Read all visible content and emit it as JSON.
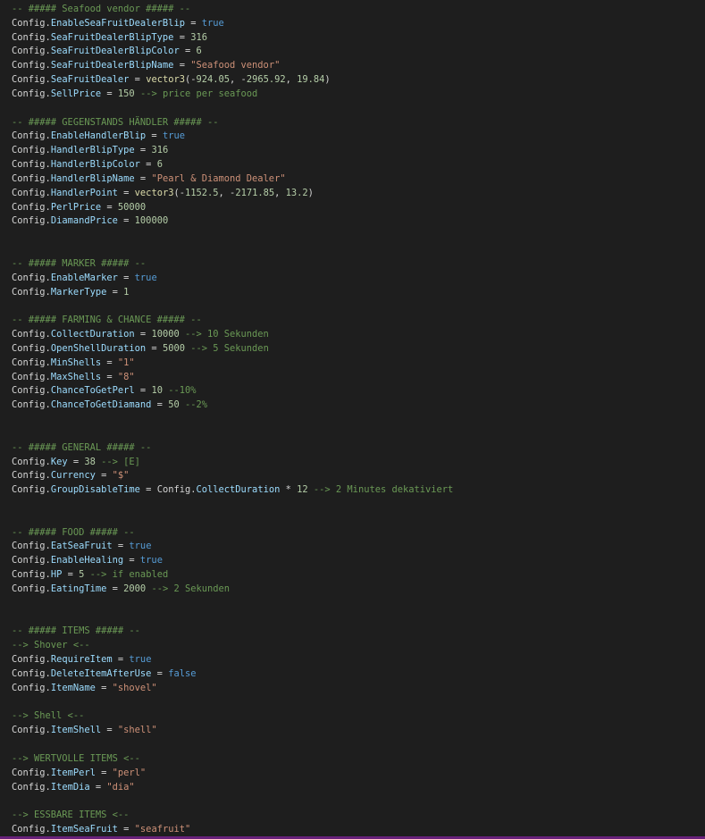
{
  "editor": {
    "theme_colors": {
      "background": "#1e1e1e",
      "comment": "#6a9955",
      "property": "#9cdcfe",
      "number": "#b5cea8",
      "string": "#ce9178",
      "keyword": "#569cd6",
      "function": "#dcdcaa",
      "status_bar": "#68217a"
    },
    "lines": [
      [
        [
          "cm",
          "-- ##### Seafood vendor ##### --"
        ]
      ],
      [
        [
          "cfg",
          "Config"
        ],
        [
          "dot",
          "."
        ],
        [
          "prop",
          "EnableSeaFruitDealerBlip"
        ],
        [
          "op",
          " = "
        ],
        [
          "kw",
          "true"
        ]
      ],
      [
        [
          "cfg",
          "Config"
        ],
        [
          "dot",
          "."
        ],
        [
          "prop",
          "SeaFruitDealerBlipType"
        ],
        [
          "op",
          " = "
        ],
        [
          "num",
          "316"
        ]
      ],
      [
        [
          "cfg",
          "Config"
        ],
        [
          "dot",
          "."
        ],
        [
          "prop",
          "SeaFruitDealerBlipColor"
        ],
        [
          "op",
          " = "
        ],
        [
          "num",
          "6"
        ]
      ],
      [
        [
          "cfg",
          "Config"
        ],
        [
          "dot",
          "."
        ],
        [
          "prop",
          "SeaFruitDealerBlipName"
        ],
        [
          "op",
          " = "
        ],
        [
          "str",
          "\"Seafood vendor\""
        ]
      ],
      [
        [
          "cfg",
          "Config"
        ],
        [
          "dot",
          "."
        ],
        [
          "prop",
          "SeaFruitDealer"
        ],
        [
          "op",
          " = "
        ],
        [
          "fn",
          "vector3"
        ],
        [
          "op",
          "(-"
        ],
        [
          "num",
          "924.05"
        ],
        [
          "op",
          ", -"
        ],
        [
          "num",
          "2965.92"
        ],
        [
          "op",
          ", "
        ],
        [
          "num",
          "19.84"
        ],
        [
          "op",
          ")"
        ]
      ],
      [
        [
          "cfg",
          "Config"
        ],
        [
          "dot",
          "."
        ],
        [
          "prop",
          "SellPrice"
        ],
        [
          "op",
          " = "
        ],
        [
          "num",
          "150"
        ],
        [
          "cm",
          " --> price per seafood"
        ]
      ],
      [],
      [
        [
          "cm",
          "-- ##### GEGENSTANDS HÄNDLER ##### --"
        ]
      ],
      [
        [
          "cfg",
          "Config"
        ],
        [
          "dot",
          "."
        ],
        [
          "prop",
          "EnableHandlerBlip"
        ],
        [
          "op",
          " = "
        ],
        [
          "kw",
          "true"
        ]
      ],
      [
        [
          "cfg",
          "Config"
        ],
        [
          "dot",
          "."
        ],
        [
          "prop",
          "HandlerBlipType"
        ],
        [
          "op",
          " = "
        ],
        [
          "num",
          "316"
        ]
      ],
      [
        [
          "cfg",
          "Config"
        ],
        [
          "dot",
          "."
        ],
        [
          "prop",
          "HandlerBlipColor"
        ],
        [
          "op",
          " = "
        ],
        [
          "num",
          "6"
        ]
      ],
      [
        [
          "cfg",
          "Config"
        ],
        [
          "dot",
          "."
        ],
        [
          "prop",
          "HandlerBlipName"
        ],
        [
          "op",
          " = "
        ],
        [
          "str",
          "\"Pearl & Diamond Dealer\""
        ]
      ],
      [
        [
          "cfg",
          "Config"
        ],
        [
          "dot",
          "."
        ],
        [
          "prop",
          "HandlerPoint"
        ],
        [
          "op",
          " = "
        ],
        [
          "fn",
          "vector3"
        ],
        [
          "op",
          "(-"
        ],
        [
          "num",
          "1152.5"
        ],
        [
          "op",
          ", -"
        ],
        [
          "num",
          "2171.85"
        ],
        [
          "op",
          ", "
        ],
        [
          "num",
          "13.2"
        ],
        [
          "op",
          ")"
        ]
      ],
      [
        [
          "cfg",
          "Config"
        ],
        [
          "dot",
          "."
        ],
        [
          "prop",
          "PerlPrice"
        ],
        [
          "op",
          " = "
        ],
        [
          "num",
          "50000"
        ]
      ],
      [
        [
          "cfg",
          "Config"
        ],
        [
          "dot",
          "."
        ],
        [
          "prop",
          "DiamandPrice"
        ],
        [
          "op",
          " = "
        ],
        [
          "num",
          "100000"
        ]
      ],
      [],
      [],
      [
        [
          "cm",
          "-- ##### MARKER ##### --"
        ]
      ],
      [
        [
          "cfg",
          "Config"
        ],
        [
          "dot",
          "."
        ],
        [
          "prop",
          "EnableMarker"
        ],
        [
          "op",
          " = "
        ],
        [
          "kw",
          "true"
        ]
      ],
      [
        [
          "cfg",
          "Config"
        ],
        [
          "dot",
          "."
        ],
        [
          "prop",
          "MarkerType"
        ],
        [
          "op",
          " = "
        ],
        [
          "num",
          "1"
        ]
      ],
      [],
      [
        [
          "cm",
          "-- ##### FARMING & CHANCE ##### --"
        ]
      ],
      [
        [
          "cfg",
          "Config"
        ],
        [
          "dot",
          "."
        ],
        [
          "prop",
          "CollectDuration"
        ],
        [
          "op",
          " = "
        ],
        [
          "num",
          "10000"
        ],
        [
          "cm",
          " --> 10 Sekunden"
        ]
      ],
      [
        [
          "cfg",
          "Config"
        ],
        [
          "dot",
          "."
        ],
        [
          "prop",
          "OpenShellDuration"
        ],
        [
          "op",
          " = "
        ],
        [
          "num",
          "5000"
        ],
        [
          "cm",
          " --> 5 Sekunden"
        ]
      ],
      [
        [
          "cfg",
          "Config"
        ],
        [
          "dot",
          "."
        ],
        [
          "prop",
          "MinShells"
        ],
        [
          "op",
          " = "
        ],
        [
          "str",
          "\"1\""
        ]
      ],
      [
        [
          "cfg",
          "Config"
        ],
        [
          "dot",
          "."
        ],
        [
          "prop",
          "MaxShells"
        ],
        [
          "op",
          " = "
        ],
        [
          "str",
          "\"8\""
        ]
      ],
      [
        [
          "cfg",
          "Config"
        ],
        [
          "dot",
          "."
        ],
        [
          "prop",
          "ChanceToGetPerl"
        ],
        [
          "op",
          " = "
        ],
        [
          "num",
          "10"
        ],
        [
          "cm",
          " --10%"
        ]
      ],
      [
        [
          "cfg",
          "Config"
        ],
        [
          "dot",
          "."
        ],
        [
          "prop",
          "ChanceToGetDiamand"
        ],
        [
          "op",
          " = "
        ],
        [
          "num",
          "50"
        ],
        [
          "cm",
          " --2%"
        ]
      ],
      [],
      [],
      [
        [
          "cm",
          "-- ##### GENERAL ##### --"
        ]
      ],
      [
        [
          "cfg",
          "Config"
        ],
        [
          "dot",
          "."
        ],
        [
          "prop",
          "Key"
        ],
        [
          "op",
          " = "
        ],
        [
          "num",
          "38"
        ],
        [
          "cm",
          " --> [E]"
        ]
      ],
      [
        [
          "cfg",
          "Config"
        ],
        [
          "dot",
          "."
        ],
        [
          "prop",
          "Currency"
        ],
        [
          "op",
          " = "
        ],
        [
          "str",
          "\"$\""
        ]
      ],
      [
        [
          "cfg",
          "Config"
        ],
        [
          "dot",
          "."
        ],
        [
          "prop",
          "GroupDisableTime"
        ],
        [
          "op",
          " = "
        ],
        [
          "cfg",
          "Config"
        ],
        [
          "dot",
          "."
        ],
        [
          "prop",
          "CollectDuration"
        ],
        [
          "op",
          " * "
        ],
        [
          "num",
          "12"
        ],
        [
          "cm",
          " --> 2 Minutes dekativiert"
        ]
      ],
      [],
      [],
      [
        [
          "cm",
          "-- ##### FOOD ##### --"
        ]
      ],
      [
        [
          "cfg",
          "Config"
        ],
        [
          "dot",
          "."
        ],
        [
          "prop",
          "EatSeaFruit"
        ],
        [
          "op",
          " = "
        ],
        [
          "kw",
          "true"
        ]
      ],
      [
        [
          "cfg",
          "Config"
        ],
        [
          "dot",
          "."
        ],
        [
          "prop",
          "EnableHealing"
        ],
        [
          "op",
          " = "
        ],
        [
          "kw",
          "true"
        ]
      ],
      [
        [
          "cfg",
          "Config"
        ],
        [
          "dot",
          "."
        ],
        [
          "prop",
          "HP"
        ],
        [
          "op",
          " = "
        ],
        [
          "num",
          "5"
        ],
        [
          "cm",
          " --> if enabled"
        ]
      ],
      [
        [
          "cfg",
          "Config"
        ],
        [
          "dot",
          "."
        ],
        [
          "prop",
          "EatingTime"
        ],
        [
          "op",
          " = "
        ],
        [
          "num",
          "2000"
        ],
        [
          "cm",
          " --> 2 Sekunden"
        ]
      ],
      [],
      [],
      [
        [
          "cm",
          "-- ##### ITEMS ##### --"
        ]
      ],
      [
        [
          "cm",
          "--> Shover <--"
        ]
      ],
      [
        [
          "cfg",
          "Config"
        ],
        [
          "dot",
          "."
        ],
        [
          "prop",
          "RequireItem"
        ],
        [
          "op",
          " = "
        ],
        [
          "kw",
          "true"
        ]
      ],
      [
        [
          "cfg",
          "Config"
        ],
        [
          "dot",
          "."
        ],
        [
          "prop",
          "DeleteItemAfterUse"
        ],
        [
          "op",
          " = "
        ],
        [
          "kw",
          "false"
        ]
      ],
      [
        [
          "cfg",
          "Config"
        ],
        [
          "dot",
          "."
        ],
        [
          "prop",
          "ItemName"
        ],
        [
          "op",
          " = "
        ],
        [
          "str",
          "\"shovel\""
        ]
      ],
      [],
      [
        [
          "cm",
          "--> Shell <--"
        ]
      ],
      [
        [
          "cfg",
          "Config"
        ],
        [
          "dot",
          "."
        ],
        [
          "prop",
          "ItemShell"
        ],
        [
          "op",
          " = "
        ],
        [
          "str",
          "\"shell\""
        ]
      ],
      [],
      [
        [
          "cm",
          "--> WERTVOLLE ITEMS <--"
        ]
      ],
      [
        [
          "cfg",
          "Config"
        ],
        [
          "dot",
          "."
        ],
        [
          "prop",
          "ItemPerl"
        ],
        [
          "op",
          " = "
        ],
        [
          "str",
          "\"perl\""
        ]
      ],
      [
        [
          "cfg",
          "Config"
        ],
        [
          "dot",
          "."
        ],
        [
          "prop",
          "ItemDia"
        ],
        [
          "op",
          " = "
        ],
        [
          "str",
          "\"dia\""
        ]
      ],
      [],
      [
        [
          "cm",
          "--> ESSBARE ITEMS <--"
        ]
      ],
      [
        [
          "cfg",
          "Config"
        ],
        [
          "dot",
          "."
        ],
        [
          "prop",
          "ItemSeaFruit"
        ],
        [
          "op",
          " = "
        ],
        [
          "str",
          "\"seafruit\""
        ]
      ]
    ]
  }
}
